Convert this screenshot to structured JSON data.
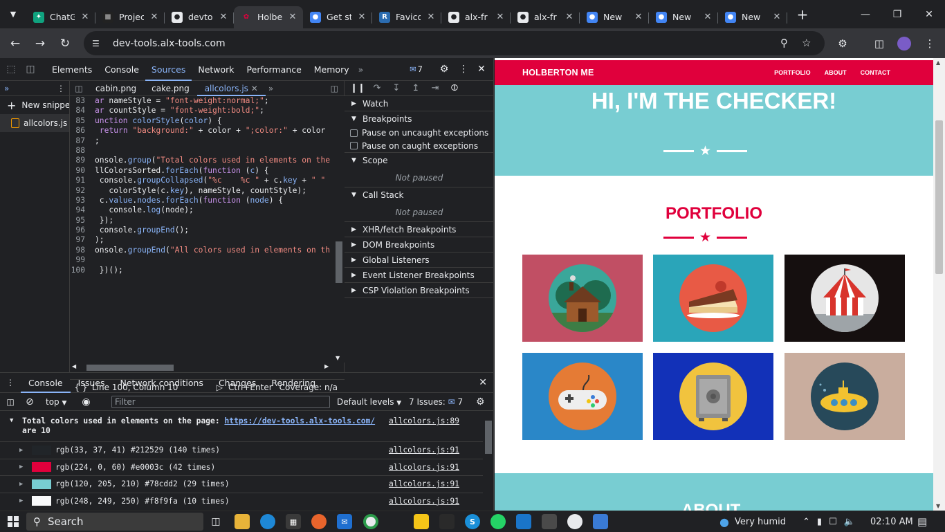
{
  "browser": {
    "tabs": [
      {
        "title": "ChatG",
        "icon": "chatgpt-icon",
        "active": false
      },
      {
        "title": "Projec",
        "icon": "project-icon",
        "active": false
      },
      {
        "title": "devto",
        "icon": "github-icon",
        "active": false
      },
      {
        "title": "Holbe",
        "icon": "holberton-icon",
        "active": true
      },
      {
        "title": "Get st",
        "icon": "chrome-icon",
        "active": false
      },
      {
        "title": "Favico",
        "icon": "realfavicon-icon",
        "active": false
      },
      {
        "title": "alx-fr",
        "icon": "github-icon",
        "active": false
      },
      {
        "title": "alx-fr",
        "icon": "github-icon",
        "active": false
      },
      {
        "title": "New",
        "icon": "chrome-icon",
        "active": false
      },
      {
        "title": "New",
        "icon": "chrome-icon",
        "active": false
      },
      {
        "title": "New",
        "icon": "chrome-icon",
        "active": false
      }
    ],
    "url": "dev-tools.alx-tools.com"
  },
  "devtools": {
    "tabs": [
      "Elements",
      "Console",
      "Sources",
      "Network",
      "Performance",
      "Memory"
    ],
    "active_tab": "Sources",
    "issues_badge": "7",
    "navigator": {
      "new_snippet": "New snippet",
      "file": "allcolors.js"
    },
    "editor_tabs": [
      "cabin.png",
      "cake.png",
      "allcolors.js"
    ],
    "code": [
      {
        "n": "83",
        "html": "<span class='kw'>ar</span> nameStyle = <span class='str'>\"font-weight:normal;\"</span>;"
      },
      {
        "n": "84",
        "html": "<span class='kw'>ar</span> countStyle = <span class='str'>\"font-weight:bold;\"</span>;"
      },
      {
        "n": "85",
        "html": "<span class='kw'>unction</span> <span class='fn'>colorStyle</span>(<span class='prop'>color</span>) {"
      },
      {
        "n": "86",
        "html": " <span class='kw'>return</span> <span class='str'>\"background:\"</span> + color + <span class='str'>\";color:\"</span> + color"
      },
      {
        "n": "87",
        "html": ";"
      },
      {
        "n": "88",
        "html": ""
      },
      {
        "n": "89",
        "html": "onsole.<span class='fn'>group</span>(<span class='str'>\"Total colors used in elements on the</span>"
      },
      {
        "n": "90",
        "html": "llColorsSorted.<span class='fn'>forEach</span>(<span class='kw'>function</span> (<span class='prop'>c</span>) {"
      },
      {
        "n": "91",
        "html": " console.<span class='fn'>groupCollapsed</span>(<span class='str'>\"%c    %c \"</span> + c.<span class='prop'>key</span> + <span class='str'>\" \"</span>"
      },
      {
        "n": "92",
        "html": "   colorStyle(c.<span class='prop'>key</span>), nameStyle, countStyle);"
      },
      {
        "n": "93",
        "html": " c.<span class='prop'>value</span>.<span class='prop'>nodes</span>.<span class='fn'>forEach</span>(<span class='kw'>function</span> (<span class='prop'>node</span>) {"
      },
      {
        "n": "94",
        "html": "   console.<span class='fn'>log</span>(node);"
      },
      {
        "n": "95",
        "html": " });"
      },
      {
        "n": "96",
        "html": " console.<span class='fn'>groupEnd</span>();"
      },
      {
        "n": "97",
        "html": ");"
      },
      {
        "n": "98",
        "html": "onsole.<span class='fn'>groupEnd</span>(<span class='str'>\"All colors used in elements on th</span>"
      },
      {
        "n": "99",
        "html": ""
      },
      {
        "n": "100",
        "html": " })();"
      }
    ],
    "status": {
      "position": "Line 100, Column 10",
      "run": "Ctrl+Enter",
      "coverage": "Coverage: n/a"
    },
    "debugger": {
      "watch": "Watch",
      "breakpoints": "Breakpoints",
      "pause_uncaught": "Pause on uncaught exceptions",
      "pause_caught": "Pause on caught exceptions",
      "scope": "Scope",
      "not_paused": "Not paused",
      "call_stack": "Call Stack",
      "sections": [
        "XHR/fetch Breakpoints",
        "DOM Breakpoints",
        "Global Listeners",
        "Event Listener Breakpoints",
        "CSP Violation Breakpoints"
      ]
    },
    "drawer": {
      "tabs": [
        "Console",
        "Issues",
        "Network conditions",
        "Changes",
        "Rendering"
      ],
      "context": "top",
      "filter_placeholder": "Filter",
      "levels": "Default levels",
      "issues": "7 Issues:",
      "issues_count": "7",
      "group_title_prefix": "Total colors used in elements on the page: ",
      "group_link": "https://dev-tools.alx-tools.com/",
      "group_title_suffix": " are 10",
      "group_source": "allcolors.js:89",
      "rows": [
        {
          "swatch": "#212529",
          "text": "rgb(33, 37, 41) #212529 (140 times)",
          "source": "allcolors.js:91"
        },
        {
          "swatch": "#e0003c",
          "text": "rgb(224, 0, 60) #e0003c (42 times)",
          "source": "allcolors.js:91"
        },
        {
          "swatch": "#78cdd2",
          "text": "rgb(120, 205, 210) #78cdd2 (29 times)",
          "source": "allcolors.js:91"
        },
        {
          "swatch": "#f8f9fa",
          "text": "rgb(248, 249, 250) #f8f9fa (10 times)",
          "source": "allcolors.js:91"
        }
      ]
    }
  },
  "site": {
    "brand": "HOLBERTON ME",
    "nav": [
      "PORTFOLIO",
      "ABOUT",
      "CONTACT"
    ],
    "hero_title": "HI, I'M THE CHECKER!",
    "portfolio_title": "PORTFOLIO",
    "about_title": "ABOUT",
    "tiles": [
      {
        "name": "cabin",
        "bg": "#c14f64"
      },
      {
        "name": "cake",
        "bg": "#2aa5b9"
      },
      {
        "name": "circus",
        "bg": "#150f0f"
      },
      {
        "name": "game",
        "bg": "#2a87c8"
      },
      {
        "name": "safe",
        "bg": "#1231b8"
      },
      {
        "name": "submarine",
        "bg": "#c9ad9e"
      }
    ],
    "colors": {
      "accent": "#e0003c",
      "teal": "#78cdd2"
    }
  },
  "taskbar": {
    "search": "Search",
    "weather": "Very humid",
    "time": "02:10 AM"
  }
}
